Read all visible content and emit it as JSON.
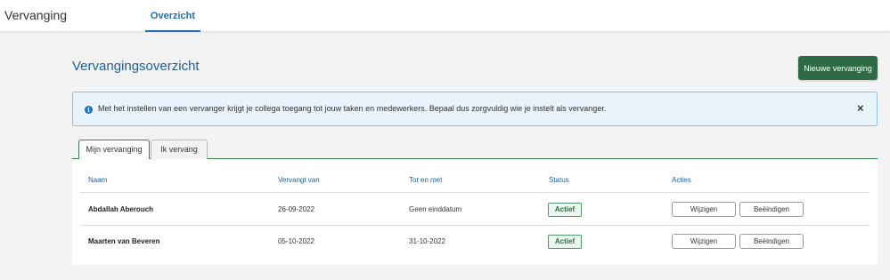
{
  "header": {
    "app_title": "Vervanging",
    "nav_tab": "Overzicht"
  },
  "page": {
    "title": "Vervangingsoverzicht",
    "new_button": "Nieuwe vervanging"
  },
  "info": {
    "text": "Met het instellen van een vervanger krijgt je collega toegang tot jouw taken en medewerkers. Bepaal dus zorgvuldig wie je instelt als vervanger.",
    "close_symbol": "×"
  },
  "tabs": [
    {
      "label": "Mijn vervanging",
      "active": true
    },
    {
      "label": "Ik vervang",
      "active": false
    }
  ],
  "table": {
    "columns": [
      "Naam",
      "Vervangt van",
      "Tot en met",
      "Status",
      "Acties"
    ],
    "rows": [
      {
        "naam": "Abdallah Aberouch",
        "van": "26-09-2022",
        "tot": "Geen einddatum",
        "status": "Actief"
      },
      {
        "naam": "Maarten van Beveren",
        "van": "05-10-2022",
        "tot": "31-10-2022",
        "status": "Actief"
      }
    ],
    "edit_label": "Wijzigen",
    "end_label": "Beëindigen"
  },
  "colors": {
    "primary_blue": "#1f6fb2",
    "green": "#2e6b45",
    "info_bg": "#e8f3fb"
  }
}
